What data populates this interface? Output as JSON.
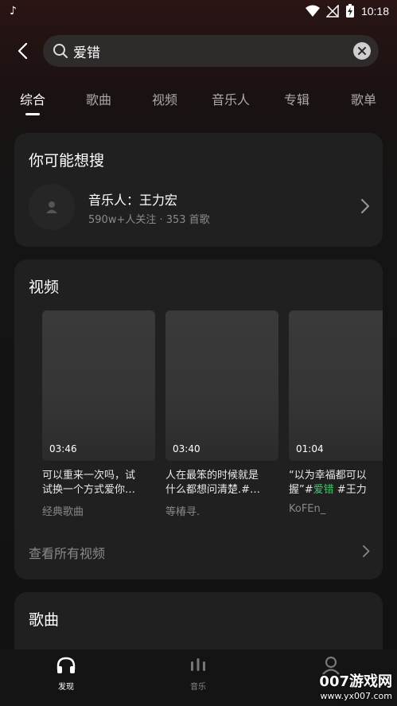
{
  "status_bar": {
    "time": "10:18"
  },
  "search": {
    "query": "爱错"
  },
  "tabs": [
    {
      "label": "综合"
    },
    {
      "label": "歌曲"
    },
    {
      "label": "视频"
    },
    {
      "label": "音乐人"
    },
    {
      "label": "专辑"
    },
    {
      "label": "歌单"
    }
  ],
  "suggest": {
    "title": "你可能想搜",
    "name": "音乐人：王力宏",
    "meta": "590w+人关注 · 353 首歌"
  },
  "videos": {
    "title": "视频",
    "items": [
      {
        "duration": "03:46",
        "caption": "可以重来一次吗，试\n试换一个方式爱你…",
        "author": "经典歌曲"
      },
      {
        "duration": "03:40",
        "caption": "人在最笨的时候就是\n什么都想问清楚.#…",
        "author": "等椿寻."
      },
      {
        "duration": "01:04",
        "caption": "“以为幸福都可以\n握”#爱错 #王力",
        "author": "KoFEn_"
      }
    ],
    "see_all": "查看所有视频"
  },
  "songs": {
    "title": "歌曲"
  },
  "bottom_nav": [
    {
      "label": "发现"
    },
    {
      "label": "音乐"
    },
    {
      "label": ""
    }
  ],
  "watermark": {
    "brand": "007游戏网",
    "url": "www.yx007.com"
  },
  "colors": {
    "background": "#121212",
    "card": "#202020",
    "accent_green": "#3ec76a"
  }
}
